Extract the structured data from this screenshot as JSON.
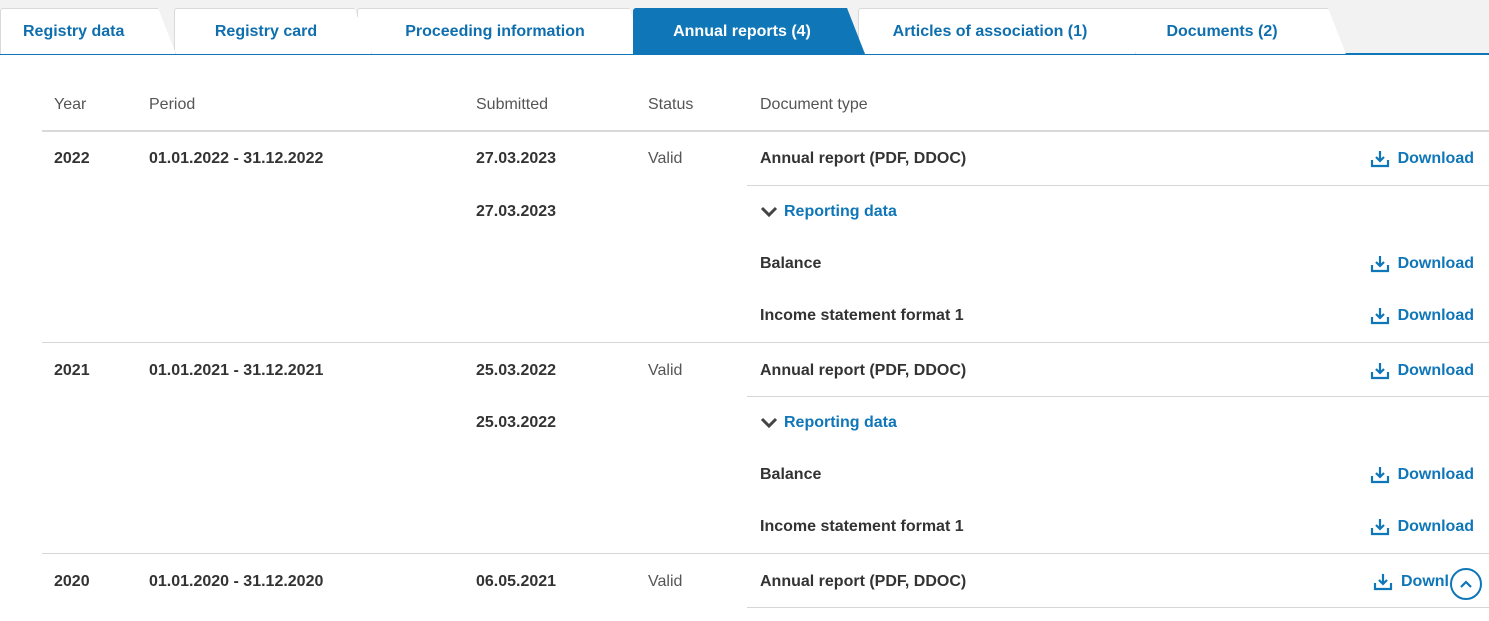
{
  "tabs": [
    {
      "label": "Registry data"
    },
    {
      "label": "Registry card"
    },
    {
      "label": "Proceeding information"
    },
    {
      "label": "Annual reports (4)"
    },
    {
      "label": "Articles of association (1)"
    },
    {
      "label": "Documents (2)"
    }
  ],
  "active_tab": "Annual reports (4)",
  "table": {
    "headers": {
      "year": "Year",
      "period": "Period",
      "submitted": "Submitted",
      "status": "Status",
      "doc_type": "Document type"
    },
    "reports": [
      {
        "year": "2022",
        "period": "01.01.2022 - 31.12.2022",
        "submitted": "27.03.2023",
        "status": "Valid",
        "document": "Annual report (PDF, DDOC)",
        "download": "Download",
        "reporting_submitted": "27.03.2023",
        "reporting_label": "Reporting data",
        "items": [
          {
            "name": "Balance",
            "download": "Download"
          },
          {
            "name": "Income statement format 1",
            "download": "Download"
          }
        ]
      },
      {
        "year": "2021",
        "period": "01.01.2021 - 31.12.2021",
        "submitted": "25.03.2022",
        "status": "Valid",
        "document": "Annual report (PDF, DDOC)",
        "download": "Download",
        "reporting_submitted": "25.03.2022",
        "reporting_label": "Reporting data",
        "items": [
          {
            "name": "Balance",
            "download": "Download"
          },
          {
            "name": "Income statement format 1",
            "download": "Download"
          }
        ]
      },
      {
        "year": "2020",
        "period": "01.01.2020 - 31.12.2020",
        "submitted": "06.05.2021",
        "status": "Valid",
        "document": "Annual report (PDF, DDOC)",
        "download": "Downl"
      }
    ]
  },
  "colors": {
    "accent": "#0f76b8",
    "tab_bg": "#f2f2f2",
    "divider": "#d6d6d6",
    "text": "#333333"
  },
  "icons": {
    "download": "download-icon",
    "expand": "chevron-down-icon",
    "scroll_top": "chevron-up-icon"
  }
}
